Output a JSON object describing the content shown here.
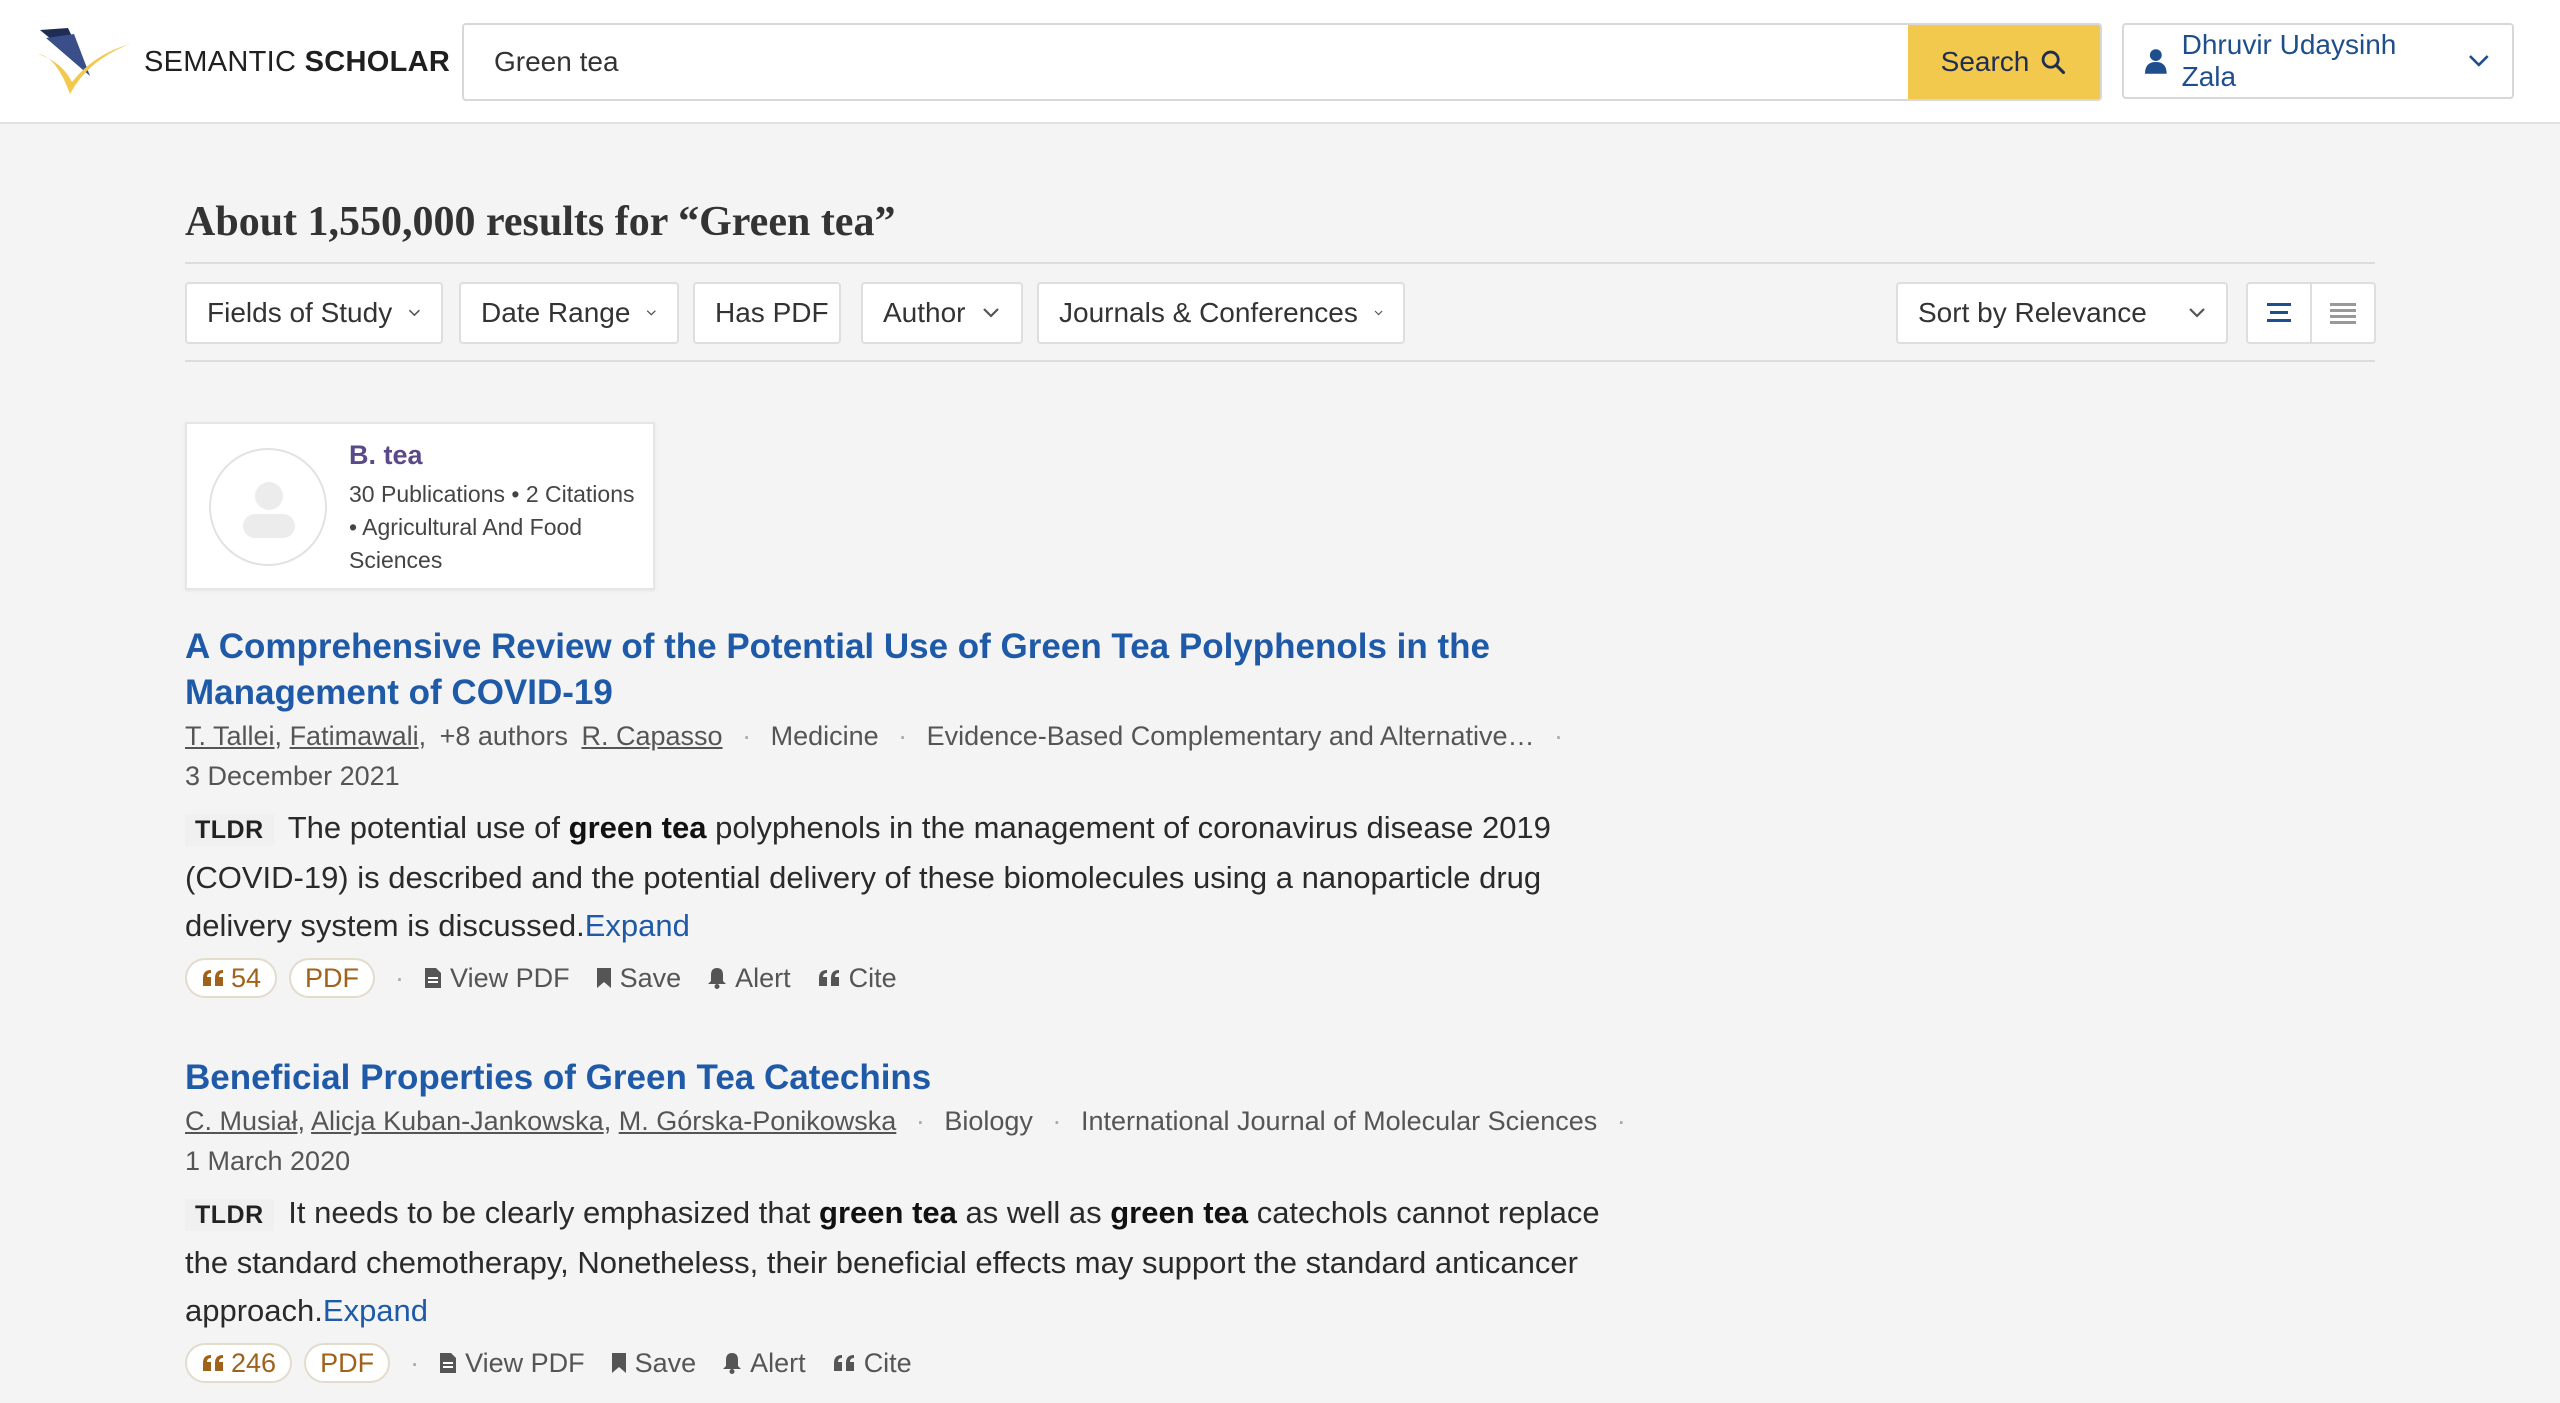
{
  "header": {
    "logo_light": "SEMANTIC ",
    "logo_bold": "SCHOLAR",
    "search_value": "Green tea",
    "search_button": "Search",
    "user_name": "Dhruvir Udaysinh Zala"
  },
  "results": {
    "title": "About 1,550,000 results for “Green tea”"
  },
  "filters": {
    "fields_of_study": "Fields of Study",
    "date_range": "Date Range",
    "has_pdf": "Has PDF",
    "author": "Author",
    "journals": "Journals & Conferences",
    "sort": "Sort by Relevance"
  },
  "author_card": {
    "name": "B. tea",
    "meta": "30 Publications • 2 Citations • Agricultural And Food Sciences"
  },
  "papers": [
    {
      "title": "A Comprehensive Review of the Potential Use of Green Tea Polyphenols in the Management of COVID-19",
      "author1": "T. Tallei",
      "author2": "Fatimawali",
      "more_authors": "+8 authors",
      "author_last": "R. Capasso",
      "field": "Medicine",
      "venue": "Evidence-Based Complementary and Alternative…",
      "date": "3 December 2021",
      "tldr_label": "TLDR",
      "tldr_1": "The potential use of ",
      "tldr_b1": "green tea",
      "tldr_2": " polyphenols in the management of coronavirus disease 2019 (COVID-19) is described and the potential delivery of these biomolecules using a nanoparticle drug delivery system is discussed.",
      "expand": "Expand",
      "citations": "54",
      "pdf": "PDF",
      "view_pdf": "View PDF",
      "save": "Save",
      "alert": "Alert",
      "cite": "Cite"
    },
    {
      "title": "Beneficial Properties of Green Tea Catechins",
      "author1": "C. Musiał",
      "author2": "Alicja Kuban-Jankowska",
      "author3": "M. Górska-Ponikowska",
      "field": "Biology",
      "venue": "International Journal of Molecular Sciences",
      "date": "1 March 2020",
      "tldr_label": "TLDR",
      "tldr_1": "It needs to be clearly emphasized that ",
      "tldr_b1": "green tea",
      "tldr_2": " as well as ",
      "tldr_b2": "green tea",
      "tldr_3": " catechols cannot replace the standard chemotherapy, Nonetheless, their beneficial effects may support the standard anticancer approach.",
      "expand": "Expand",
      "citations": "246",
      "pdf": "PDF",
      "view_pdf": "View PDF",
      "save": "Save",
      "alert": "Alert",
      "cite": "Cite"
    }
  ],
  "colors": {
    "accent_yellow": "#f2c94c",
    "link_blue": "#1f5aa8",
    "citation_orange": "#a0621a"
  }
}
